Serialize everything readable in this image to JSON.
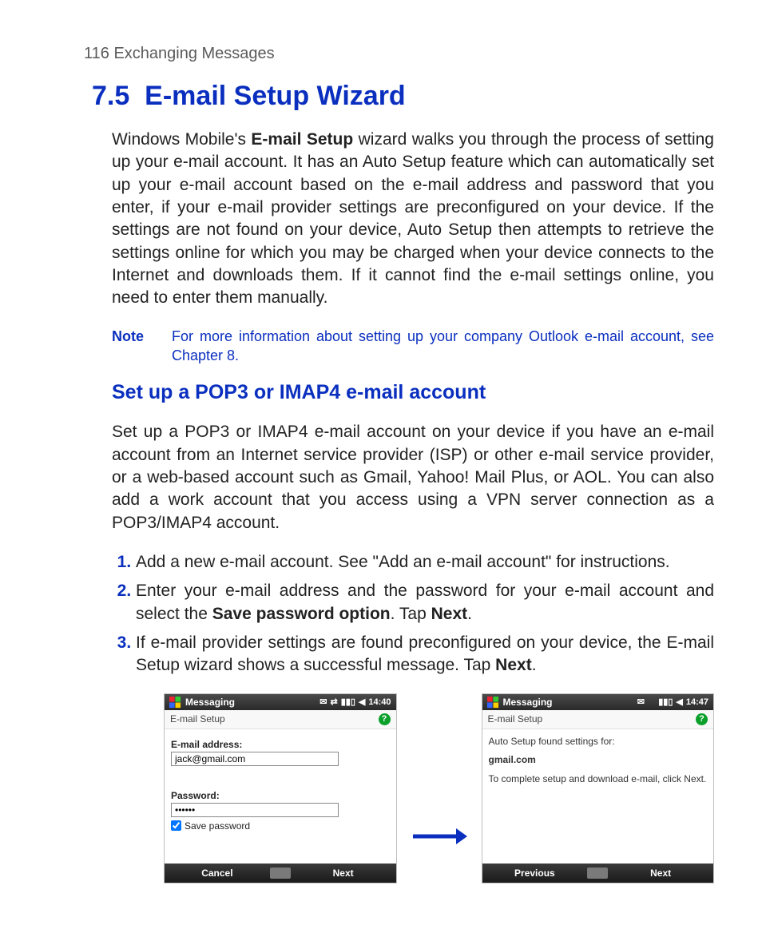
{
  "running_head": "116  Exchanging Messages",
  "section_number": "7.5",
  "section_title": "E-mail Setup Wizard",
  "intro_part1": "Windows Mobile's ",
  "intro_bold": "E-mail Setup",
  "intro_part2": " wizard walks you through the process of setting up your e-mail account. It has an Auto Setup feature which can automatically set up your e-mail account based on the e-mail address and password that you enter, if your e-mail provider settings are preconfigured on your device. If the settings are not found on your device, Auto Setup then attempts to retrieve the settings online for which you may be charged when your device connects to the Internet and downloads them. If it cannot find the e-mail settings online, you need to enter them manually.",
  "note_label": "Note",
  "note_body": "For more information about setting up your company Outlook e-mail account, see Chapter 8.",
  "subhead": "Set up a POP3 or IMAP4 e-mail account",
  "sub_body": "Set up a POP3 or IMAP4 e-mail account on your device if you have an e-mail account from an Internet service provider (ISP) or other e-mail service provider, or a web-based account such as Gmail, Yahoo! Mail Plus, or AOL. You can also add a work account that you access using a VPN server connection as a POP3/IMAP4 account.",
  "steps": {
    "s1": "Add a new e-mail account. See \"Add an e-mail account\" for instructions.",
    "s2a": "Enter your e-mail address and the password for your e-mail account and select the ",
    "s2b": "Save password option",
    "s2c": ". Tap ",
    "s2d": "Next",
    "s2e": ".",
    "s3a": "If e-mail provider settings are found preconfigured on your device, the E-mail Setup wizard shows a successful message. Tap ",
    "s3b": "Next",
    "s3c": "."
  },
  "screen1": {
    "header_title": "Messaging",
    "time": "14:40",
    "sub": "E-mail Setup",
    "email_label": "E-mail address:",
    "email_value": "jack@gmail.com",
    "password_label": "Password:",
    "password_value": "••••••",
    "save_label": "Save password",
    "left_btn": "Cancel",
    "right_btn": "Next"
  },
  "screen2": {
    "header_title": "Messaging",
    "time": "14:47",
    "sub": "E-mail Setup",
    "msg1": "Auto Setup found settings for:",
    "provider": "gmail.com",
    "msg2": "To complete setup and download e-mail, click Next.",
    "left_btn": "Previous",
    "right_btn": "Next"
  }
}
